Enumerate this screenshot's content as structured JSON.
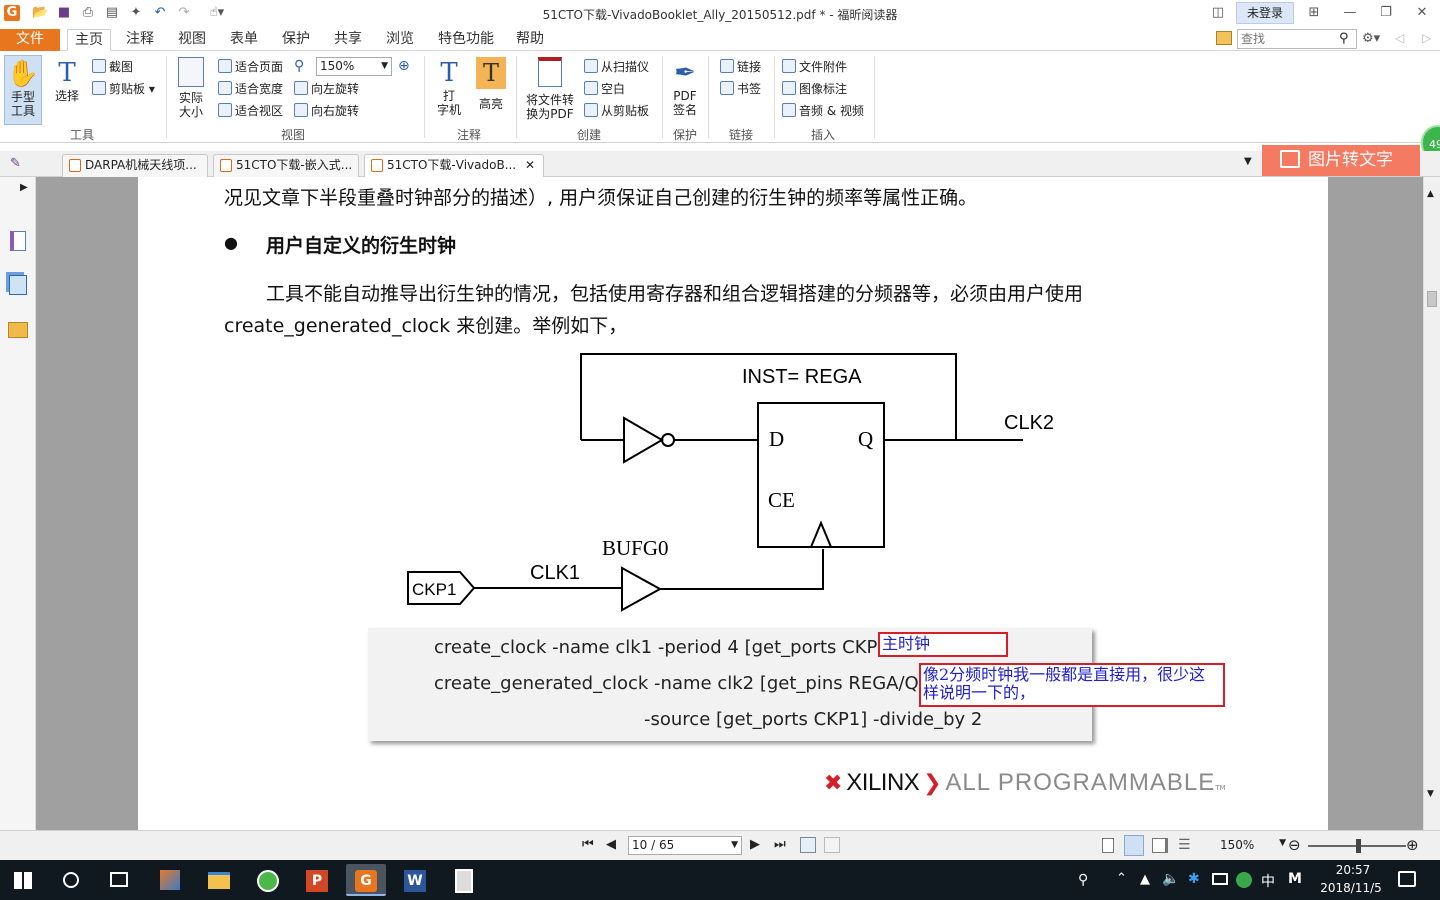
{
  "window": {
    "title": "51CTO下载-VivadoBooklet_Ally_20150512.pdf * - 福昕阅读器",
    "login": "未登录"
  },
  "menu": {
    "items": [
      "文件",
      "主页",
      "注释",
      "视图",
      "表单",
      "保护",
      "共享",
      "浏览",
      "特色功能",
      "帮助"
    ],
    "active": "主页"
  },
  "search": {
    "placeholder": "查找"
  },
  "ribbon": {
    "tools": {
      "hand": "手型\n工具",
      "select": "选择",
      "screenshot": "截图",
      "clipboard": "剪贴板",
      "group": "工具"
    },
    "view": {
      "actual_size": "实际\n大小",
      "fit_page": "适合页面",
      "fit_width": "适合宽度",
      "fit_visible": "适合视区",
      "zoom": "150%",
      "rotate_left": "向左旋转",
      "rotate_right": "向右旋转",
      "group": "视图"
    },
    "comment": {
      "typewriter": "打\n字机",
      "highlight": "高亮",
      "group": "注释"
    },
    "create": {
      "convert": "将文件转\n换为PDF",
      "from_scanner": "从扫描仪",
      "blank": "空白",
      "from_clipboard": "从剪贴板",
      "group": "创建"
    },
    "protect": {
      "sign": "PDF\n签名",
      "group": "保护"
    },
    "links": {
      "link": "链接",
      "bookmark": "书签",
      "group": "链接"
    },
    "insert": {
      "attachment": "文件附件",
      "image_annot": "图像标注",
      "audio_video": "音频 & 视频",
      "group": "插入"
    }
  },
  "tabs": [
    {
      "label": "DARPA机械天线项..."
    },
    {
      "label": "51CTO下载-嵌入式..."
    },
    {
      "label": "51CTO下载-VivadoB..."
    }
  ],
  "ocr_button": "图片转文字",
  "badge": "49",
  "doc": {
    "line1": "况见文章下半段重叠时钟部分的描述）, 用户须保证自己创建的衍生钟的频率等属性正确。",
    "bullet": "●",
    "heading": "用户自定义的衍生时钟",
    "para1": "工具不能自动推导出衍生钟的情况，包括使用寄存器和组合逻辑搭建的分频器等，必须由用户使用",
    "para2": "create_generated_clock 来创建。举例如下，",
    "diagram": {
      "inst": "INST= REGA",
      "d": "D",
      "q": "Q",
      "ce": "CE",
      "clk2": "CLK2",
      "bufg": "BUFG0",
      "clk1": "CLK1",
      "ckp1": "CKP1"
    },
    "code": [
      "create_clock -name clk1  -period 4 [get_ports CKP1]",
      "create_generated_clock  -name clk2 [get_pins REGA/Q] \\",
      "-source [get_ports CKP1] -divide_by 2"
    ],
    "note1": "主时钟",
    "note2": "像2分频时钟我一般都是直接用，很少这样说明一下的，",
    "footer_brand": "XILINX",
    "footer_tag": "ALL PROGRAMMABLE",
    "footer_tm": "TM"
  },
  "status": {
    "page": "10 / 65",
    "zoom": "150%"
  },
  "taskbar": {
    "time": "20:57",
    "date": "2018/11/5",
    "ime": "中",
    "ime2": "M"
  }
}
